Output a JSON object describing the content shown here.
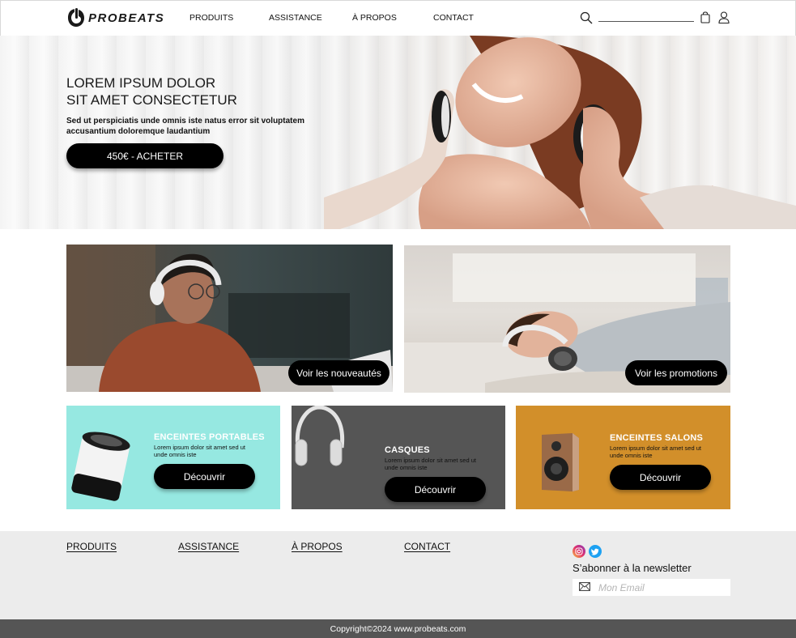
{
  "brand": {
    "name": "PROBEATS"
  },
  "nav": {
    "items": [
      {
        "label": "PRODUITS"
      },
      {
        "label": "ASSISTANCE"
      },
      {
        "label": "À PROPOS"
      },
      {
        "label": "CONTACT"
      }
    ],
    "icons": [
      "search-icon",
      "shopping-bag-icon",
      "user-icon"
    ]
  },
  "hero": {
    "title_line1": "LOREM IPSUM DOLOR",
    "title_line2": "SIT AMET CONSECTETUR",
    "subtitle": "Sed ut perspiciatis unde omnis iste natus error sit voluptatem accusantium doloremque laudantium",
    "button_label": "450€ - ACHETER"
  },
  "promos": [
    {
      "button_label": "Voir les nouveautés"
    },
    {
      "button_label": "Voir les promotions"
    }
  ],
  "categories": [
    {
      "title": "ENCEINTES PORTABLES",
      "description": "Lorem ipsum dolor sit amet sed ut unde omnis iste",
      "button_label": "Découvrir",
      "background": "#96e8e1"
    },
    {
      "title": "CASQUES",
      "description": "Lorem ipsum dolor sit amet sed ut unde omnis iste",
      "button_label": "Découvrir",
      "background": "#555555"
    },
    {
      "title": "ENCEINTES SALONS",
      "description": "Lorem ipsum dolor sit amet sed ut unde omnis iste",
      "button_label": "Découvrir",
      "background": "#d28f2a"
    }
  ],
  "footer": {
    "links": [
      {
        "label": "PRODUITS"
      },
      {
        "label": "ASSISTANCE"
      },
      {
        "label": "À PROPOS"
      },
      {
        "label": "CONTACT"
      }
    ],
    "social_icons": [
      "instagram-icon",
      "twitter-icon"
    ],
    "newsletter_label": "S’abonner à la newsletter",
    "email_placeholder": "Mon Email",
    "copyright": "Copyright©2024 www.probeats.com"
  },
  "colors": {
    "accent_dark": "#000000",
    "footer_bg": "#ececec",
    "copyright_bg": "#555555"
  }
}
